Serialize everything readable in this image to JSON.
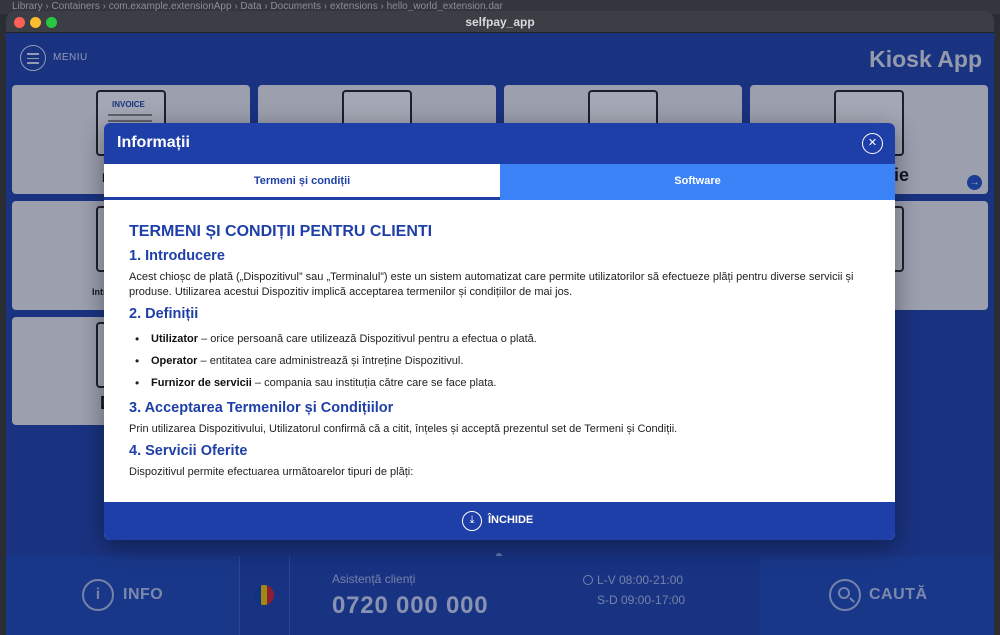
{
  "window": {
    "title": "selfpay_app"
  },
  "desktop": {
    "path_text": "Library  ›  Containers  ›  com.example.extensionApp  ›  Data  ›  Documents  ›  extensions  ›  hello_world_extension.dar"
  },
  "header": {
    "menu_label": "MENIU",
    "app_title": "Kiosk App"
  },
  "tiles": {
    "row1": [
      "P",
      "",
      "",
      "ie"
    ],
    "row2": [
      "Intr",
      "",
      "",
      ""
    ],
    "row3": [
      "D"
    ],
    "invoice_icon_text": "INVOICE"
  },
  "modal": {
    "title": "Informații",
    "tabs": [
      {
        "label": "Termeni și condiții",
        "active": true
      },
      {
        "label": "Software",
        "active": false
      }
    ],
    "content": {
      "heading": "TERMENI ȘI CONDIȚII PENTRU CLIENTI",
      "s1_title": "1. Introducere",
      "s1_text": "Acest chioșc de plată („Dispozitivul” sau „Terminalul”) este un sistem automatizat care permite utilizatorilor să efectueze plăți pentru diverse servicii și produse. Utilizarea acestui Dispozitiv implică acceptarea termenilor și condițiilor de mai jos.",
      "s2_title": "2. Definiții",
      "definitions": [
        {
          "term": "Utilizator",
          "text": " – orice persoană care utilizează Dispozitivul pentru a efectua o plată."
        },
        {
          "term": "Operator",
          "text": " – entitatea care administrează și întreține Dispozitivul."
        },
        {
          "term": "Furnizor de servicii",
          "text": " – compania sau instituția către care se face plata."
        }
      ],
      "s3_title": "3. Acceptarea Termenilor și Condițiilor",
      "s3_text": "Prin utilizarea Dispozitivului, Utilizatorul confirmă că a citit, înțeles și acceptă prezentul set de Termeni și Condiții.",
      "s4_title": "4. Servicii Oferite",
      "s4_text": "Dispozitivul permite efectuarea următoarelor tipuri de plăți:"
    },
    "close_label": "ÎNCHIDE"
  },
  "bottom": {
    "info_label": "INFO",
    "support_title": "Asistență clienți",
    "support_phone": "0720 000 000",
    "hours_weekdays": "L-V 08:00-21:00",
    "hours_weekend": "S-D 09:00-17:00",
    "search_label": "CAUTĂ"
  },
  "colors": {
    "primary": "#1e3fa7",
    "tab_inactive": "#3b82f6",
    "flag": [
      "#0b3fa8",
      "#f2c200",
      "#d21f2e"
    ]
  }
}
